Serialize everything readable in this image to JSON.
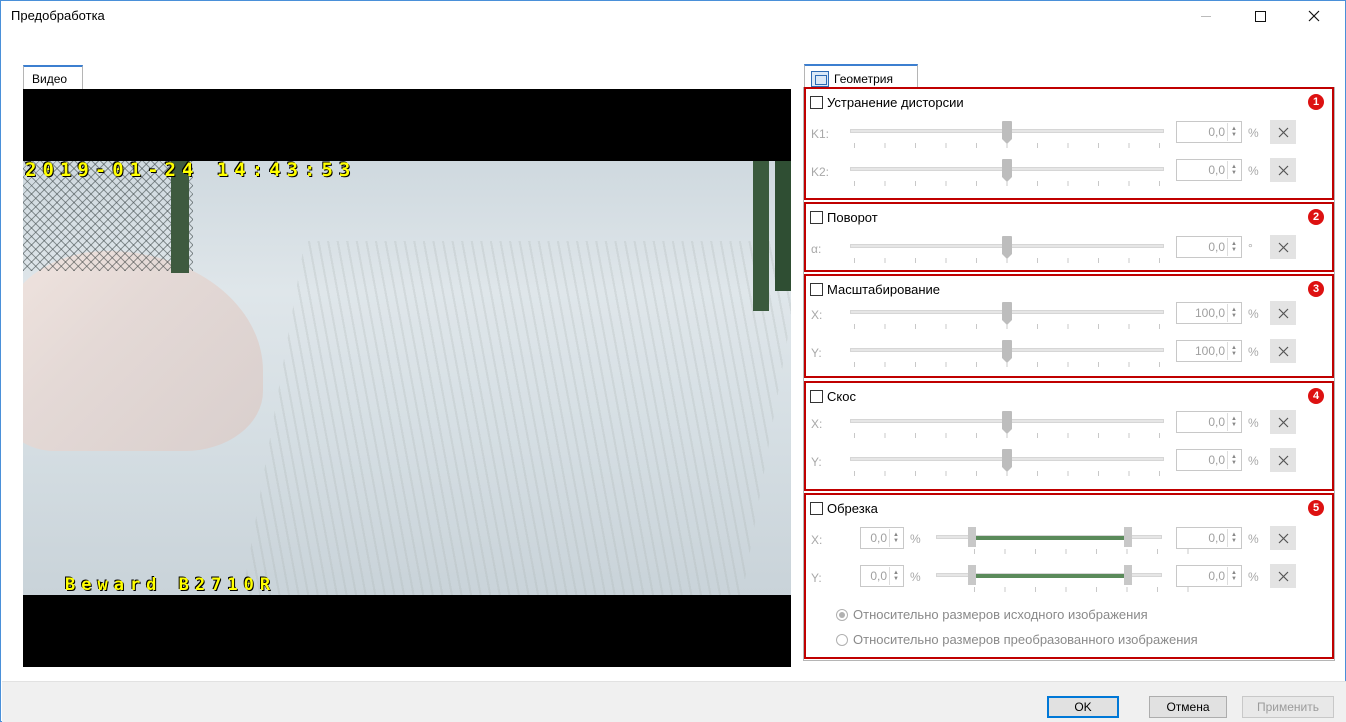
{
  "window": {
    "title": "Предобработка",
    "accent_color": "#3c7fd0"
  },
  "left_tab": {
    "label": "Видео"
  },
  "video": {
    "osd_time": "2019-01-24 14:43:53",
    "osd_model": "Beward B2710R"
  },
  "right_tab": {
    "label": "Геометрия",
    "icon": "geometry-icon"
  },
  "sections": {
    "distortion": {
      "title": "Устранение дисторсии",
      "badge": "1",
      "checked": false,
      "rows": [
        {
          "label": "K1:",
          "value": "0,0",
          "unit": "%"
        },
        {
          "label": "K2:",
          "value": "0,0",
          "unit": "%"
        }
      ]
    },
    "rotation": {
      "title": "Поворот",
      "badge": "2",
      "checked": false,
      "rows": [
        {
          "label": "α:",
          "value": "0,0",
          "unit": "°"
        }
      ]
    },
    "scaling": {
      "title": "Масштабирование",
      "badge": "3",
      "checked": false,
      "rows": [
        {
          "label": "X:",
          "value": "100,0",
          "unit": "%"
        },
        {
          "label": "Y:",
          "value": "100,0",
          "unit": "%"
        }
      ]
    },
    "skew": {
      "title": "Скос",
      "badge": "4",
      "checked": false,
      "rows": [
        {
          "label": "X:",
          "value": "0,0",
          "unit": "%"
        },
        {
          "label": "Y:",
          "value": "0,0",
          "unit": "%"
        }
      ]
    },
    "crop": {
      "title": "Обрезка",
      "badge": "5",
      "checked": false,
      "rows": [
        {
          "label": "X:",
          "value_left": "0,0",
          "value_right": "0,0",
          "unit": "%"
        },
        {
          "label": "Y:",
          "value_left": "0,0",
          "value_right": "0,0",
          "unit": "%"
        }
      ],
      "options": [
        {
          "label": "Относительно размеров исходного изображения",
          "selected": true
        },
        {
          "label": "Относительно размеров преобразованного изображения",
          "selected": false
        }
      ]
    }
  },
  "footer": {
    "ok": "OK",
    "cancel": "Отмена",
    "apply": "Применить"
  }
}
